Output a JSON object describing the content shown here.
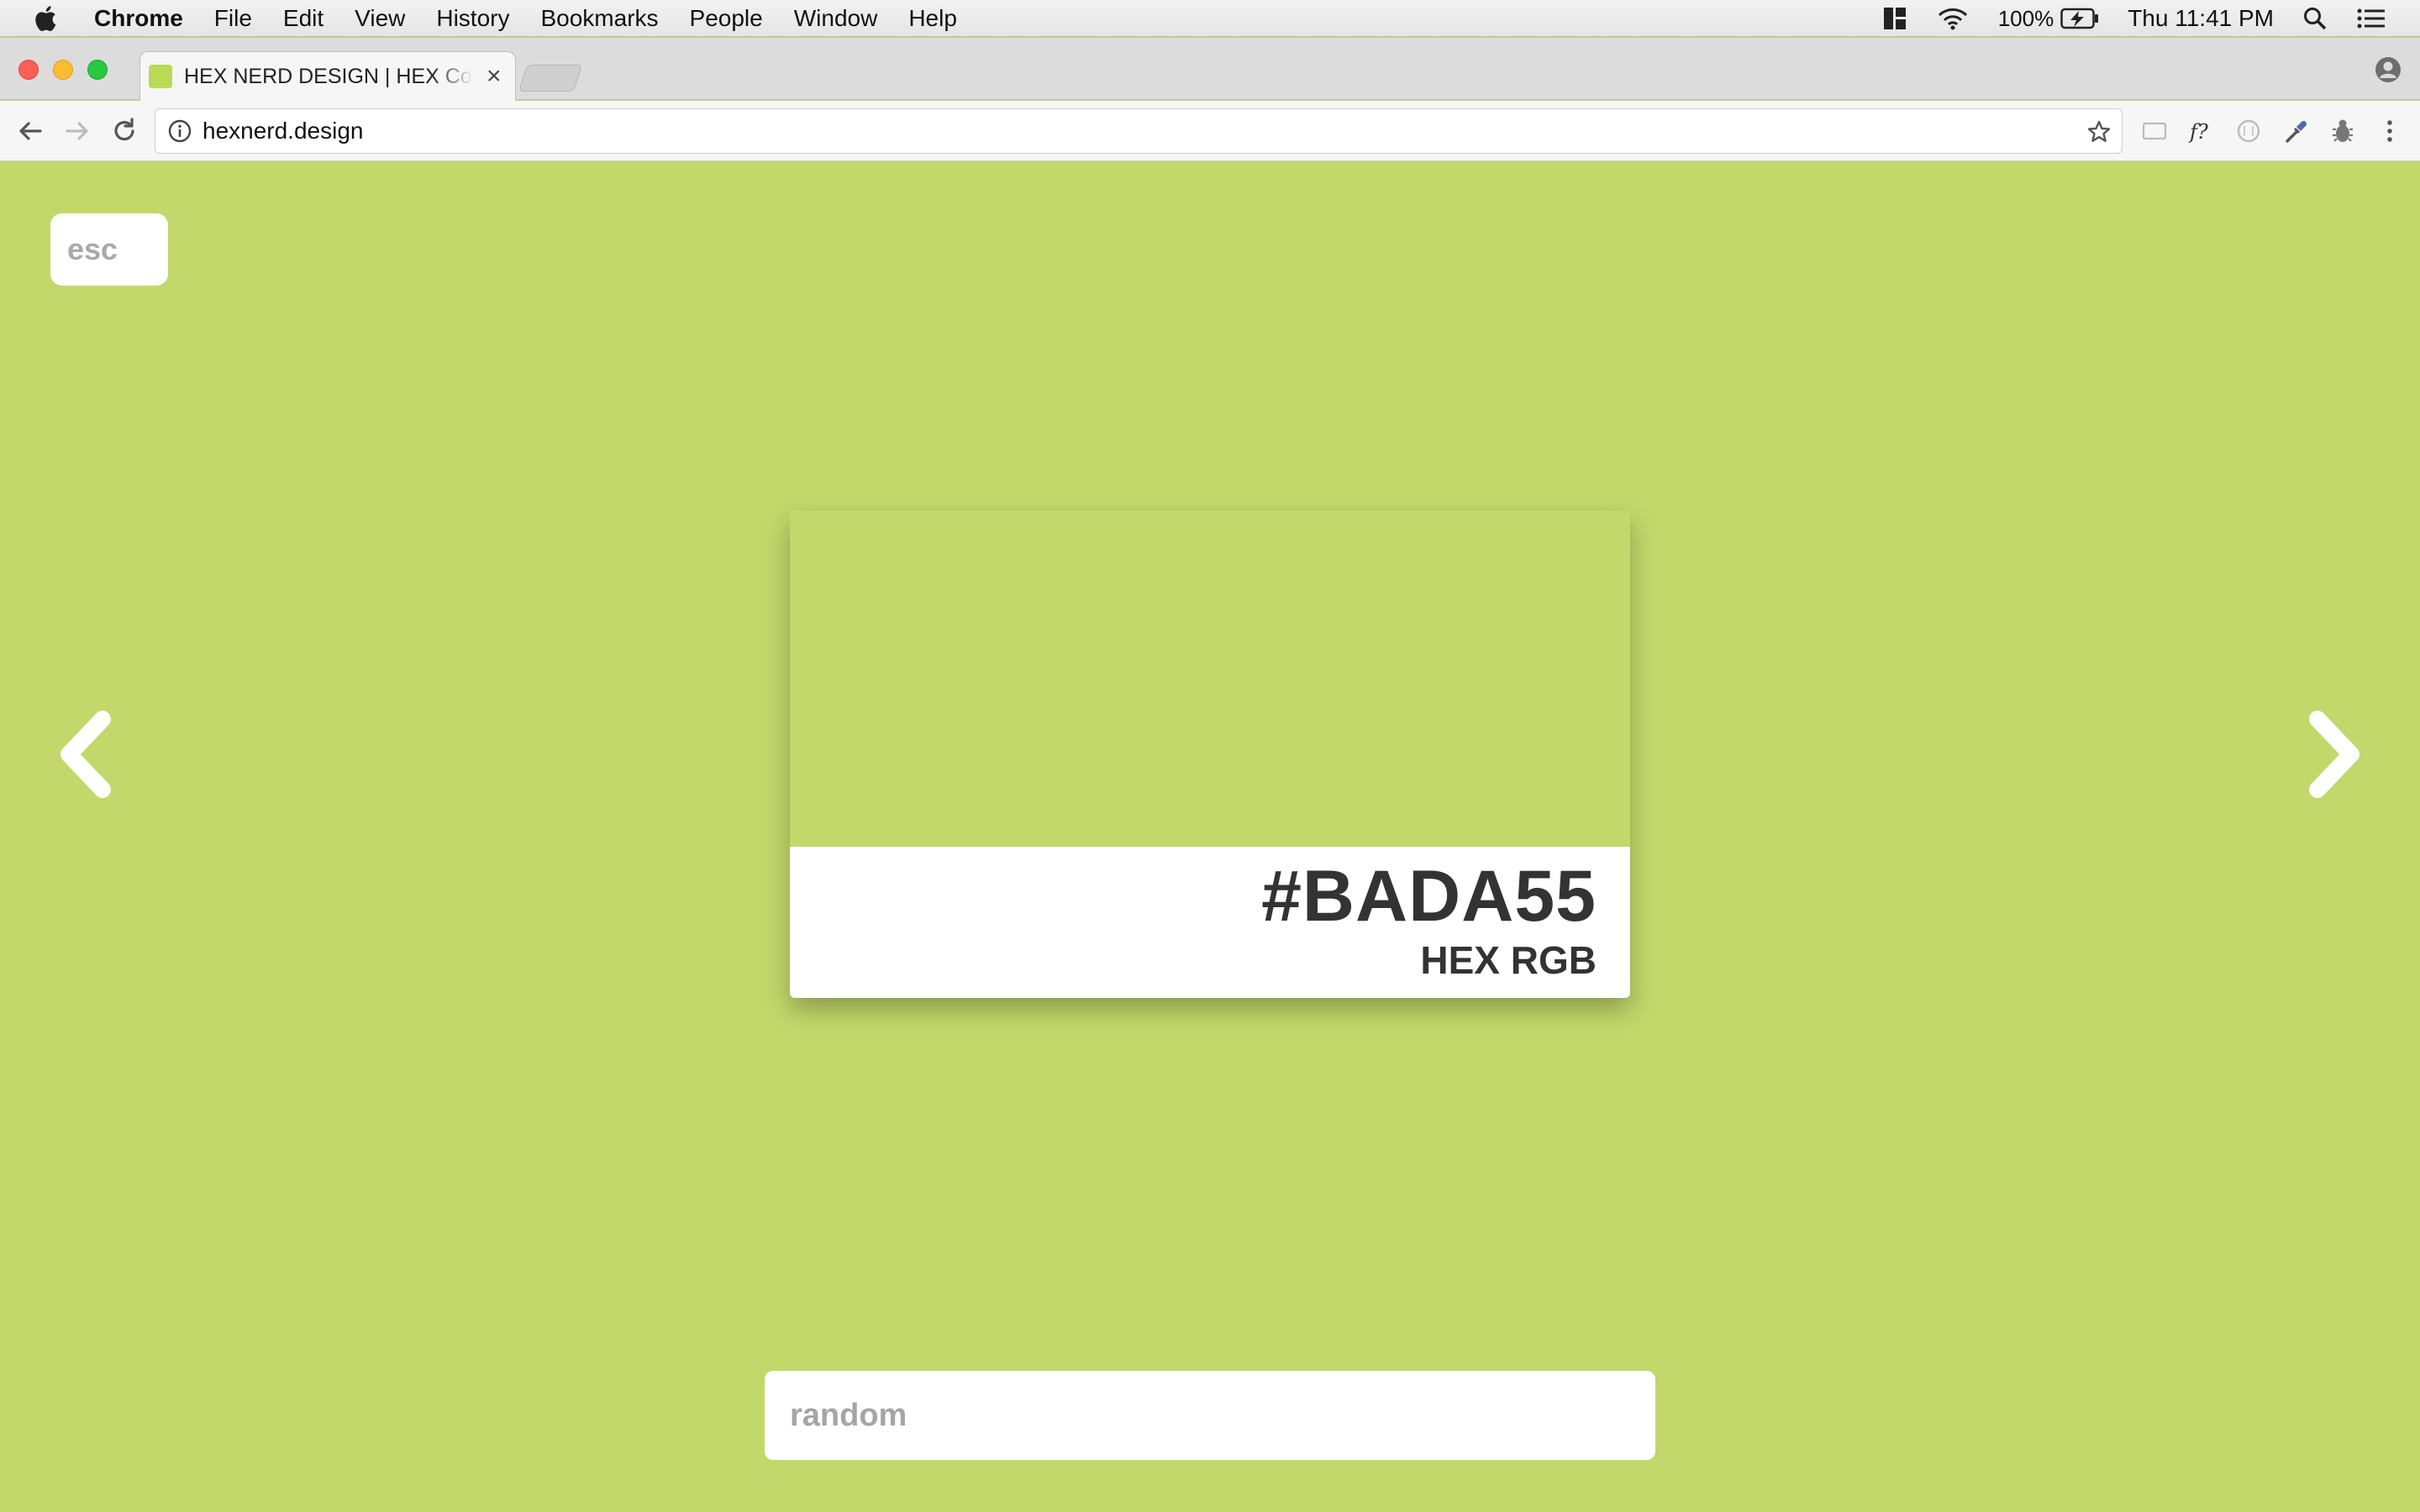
{
  "menubar": {
    "app_name": "Chrome",
    "items": [
      "File",
      "Edit",
      "View",
      "History",
      "Bookmarks",
      "People",
      "Window",
      "Help"
    ],
    "battery": "100%",
    "clock": "Thu 11:41 PM"
  },
  "browser": {
    "tab_title": "HEX NERD DESIGN | HEX Colo",
    "url": "hexnerd.design",
    "favicon_color": "#bada55"
  },
  "page": {
    "background_color": "#c2d86a",
    "esc_label": "esc",
    "swatch_color": "#c2d86a",
    "hex_code": "#BADA55",
    "format_label": "HEX RGB",
    "search_placeholder": "random",
    "search_value": ""
  },
  "icons": {
    "apple": "apple-icon",
    "layout": "grid-layout-icon",
    "wifi": "wifi-icon",
    "battery": "battery-charging-icon",
    "spotlight": "search-icon",
    "notifications": "list-icon",
    "prev": "chevron-left-icon",
    "next": "chevron-right-icon"
  }
}
